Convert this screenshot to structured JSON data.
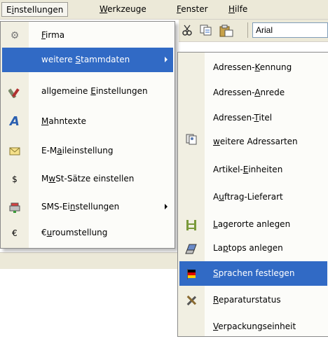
{
  "menubar": {
    "items": [
      {
        "pre": "E",
        "acc": "i",
        "post": "nstellungen"
      },
      {
        "pre": "",
        "acc": "W",
        "post": "erkzeuge"
      },
      {
        "pre": "",
        "acc": "F",
        "post": "enster"
      },
      {
        "pre": "",
        "acc": "H",
        "post": "ilfe"
      }
    ]
  },
  "toolbar": {
    "font_value": "Arial"
  },
  "menu_einstellungen": {
    "items": [
      {
        "pre": "",
        "acc": "F",
        "post": "irma",
        "icon": "gear-icon",
        "glyph": "⚙"
      },
      {
        "pre": "weitere ",
        "acc": "S",
        "post": "tammdaten",
        "icon": "",
        "glyph": "",
        "highlighted": true,
        "submenu": true
      },
      {
        "pre": "allgemeine ",
        "acc": "E",
        "post": "instellungen",
        "icon": "tools-icon",
        "glyph": "🔧"
      },
      {
        "pre": "",
        "acc": "M",
        "post": "ahntexte",
        "icon": "letter-a-icon",
        "glyph": "A"
      },
      {
        "pre": "E-M",
        "acc": "a",
        "post": "ileinstellung",
        "icon": "envelope-icon",
        "glyph": "✉"
      },
      {
        "pre": "M",
        "acc": "w",
        "post": "St-Sätze einstellen",
        "icon": "dollar-icon",
        "glyph": "$"
      },
      {
        "pre": "SMS-Ei",
        "acc": "n",
        "post": "stellungen",
        "icon": "phone-icon",
        "glyph": "☎",
        "submenu": true
      },
      {
        "pre": "€",
        "acc": "u",
        "post": "roumstellung",
        "icon": "euro-icon",
        "glyph": "€"
      }
    ]
  },
  "submenu_stammdaten": {
    "items": [
      {
        "pre": "Adressen-",
        "acc": "K",
        "post": "ennung",
        "icon": "",
        "glyph": ""
      },
      {
        "pre": "Adressen-",
        "acc": "A",
        "post": "nrede",
        "icon": "",
        "glyph": ""
      },
      {
        "pre": "Adressen-",
        "acc": "T",
        "post": "itel",
        "icon": "",
        "glyph": ""
      },
      {
        "pre": "",
        "acc": "w",
        "post": "eitere Adressarten",
        "icon": "address-cards-icon",
        "glyph": "▤"
      },
      {
        "pre": "Artikel-",
        "acc": "E",
        "post": "inheiten",
        "icon": "",
        "glyph": ""
      },
      {
        "pre": "A",
        "acc": "u",
        "post": "ftrag-Lieferart",
        "icon": "",
        "glyph": ""
      },
      {
        "pre": "",
        "acc": "L",
        "post": "agerorte anlegen",
        "icon": "shelf-icon",
        "glyph": "▥"
      },
      {
        "pre": "La",
        "acc": "p",
        "post": "tops anlegen",
        "icon": "laptop-icon",
        "glyph": "▱"
      },
      {
        "pre": "",
        "acc": "S",
        "post": "prachen festlegen",
        "icon": "german-flag-icon",
        "glyph": "⚑",
        "highlighted": true
      },
      {
        "pre": "",
        "acc": "R",
        "post": "eparaturstatus",
        "icon": "repair-tools-icon",
        "glyph": "⚒"
      },
      {
        "pre": "",
        "acc": "V",
        "post": "erpackungseinheit",
        "icon": "",
        "glyph": ""
      }
    ]
  },
  "colors": {
    "highlight": "#316ac5",
    "menubar": "#ece9d8"
  }
}
